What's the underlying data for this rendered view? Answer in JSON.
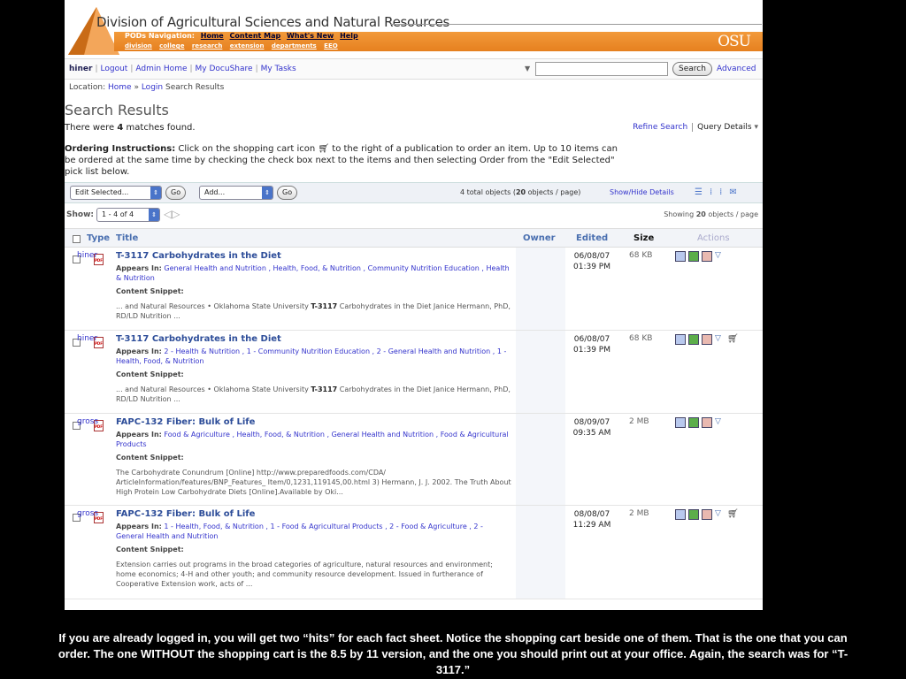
{
  "header": {
    "site_title": "Division of Agricultural Sciences and Natural Resources",
    "pods_label": "PODs Navigation:",
    "pods_links": [
      "Home",
      "Content Map",
      "What's New",
      "Help"
    ],
    "sub_links": [
      "division",
      "college",
      "research",
      "extension",
      "departments",
      "EEO"
    ],
    "logo_text": "OSU"
  },
  "userbar": {
    "username": "hiner",
    "links": [
      "Logout",
      "Admin Home",
      "My DocuShare",
      "My Tasks"
    ],
    "search_value": "",
    "search_button": "Search",
    "advanced_link": "Advanced"
  },
  "location": {
    "label": "Location:",
    "home": "Home",
    "sep": "»",
    "login": "Login",
    "current": "Search Results"
  },
  "page": {
    "title": "Search Results",
    "matches_prefix": "There were",
    "matches_count": "4",
    "matches_suffix": "matches found.",
    "refine_search": "Refine Search",
    "query_details": "Query Details",
    "ordering_label": "Ordering Instructions:",
    "ordering_text_1": "Click on the shopping cart icon",
    "ordering_text_2": "to the right of a publication to order an item. Up to 10 items can be ordered at the same time by checking the check box next to the items and then selecting Order from the \"Edit Selected\" pick list below."
  },
  "toolbar": {
    "edit_selected": "Edit Selected...",
    "go_label": "Go",
    "add_label": "Add...",
    "total_count": "4",
    "total_objects_text": "total objects",
    "per_page": "20",
    "per_page_text": "objects / page",
    "show_hide": "Show/Hide Details"
  },
  "showbar": {
    "show_label": "Show:",
    "range": "1 - 4 of 4",
    "showing_prefix": "Showing",
    "showing_count": "20",
    "showing_suffix": "objects / page"
  },
  "table": {
    "columns": {
      "type": "Type",
      "title": "Title",
      "owner": "Owner",
      "edited": "Edited",
      "size": "Size",
      "actions": "Actions"
    },
    "appears_label": "Appears In:",
    "snippet_label": "Content Snippet:",
    "rows": [
      {
        "title": "T-3117 Carbohydrates in the Diet",
        "appears": "General Health and Nutrition ,  Health, Food, & Nutrition ,  Community Nutrition Education ,  Health & Nutrition",
        "snippet_pre": "... and Natural Resources • Oklahoma State University",
        "snippet_bold": "T-3117",
        "snippet_post": "Carbohydrates in the Diet Janice Hermann, PhD, RD/LD Nutrition ...",
        "owner": "hiner",
        "edited_date": "06/08/07",
        "edited_time": "01:39 PM",
        "size": "68 KB",
        "has_cart": false
      },
      {
        "title": "T-3117 Carbohydrates in the Diet",
        "appears": "2 - Health & Nutrition ,  1 - Community Nutrition Education ,  2 - General Health and Nutrition ,  1 - Health, Food, & Nutrition",
        "snippet_pre": "... and Natural Resources • Oklahoma State University",
        "snippet_bold": "T-3117",
        "snippet_post": "Carbohydrates in the Diet Janice Hermann, PhD, RD/LD Nutrition ...",
        "owner": "hiner",
        "edited_date": "06/08/07",
        "edited_time": "01:39 PM",
        "size": "68 KB",
        "has_cart": true
      },
      {
        "title": "FAPC-132 Fiber: Bulk of Life",
        "appears": "Food & Agriculture ,  Health, Food, & Nutrition ,  General Health and Nutrition ,  Food & Agricultural Products",
        "snippet_pre": "The Carbohydrate Conundrum [Online] http://www.preparedfoods.com/CDA/ ArticleInformation/features/BNP_Features_ Item/0,1231,119145,00.html 3) Hermann, J. J. 2002. The Truth About High Protein Low Carbohydrate Diets [Online].Available by Oki...",
        "snippet_bold": "",
        "snippet_post": "",
        "owner": "gross",
        "edited_date": "08/09/07",
        "edited_time": "09:35 AM",
        "size": "2 MB",
        "has_cart": false
      },
      {
        "title": "FAPC-132 Fiber: Bulk of Life",
        "appears": "1 - Health, Food, & Nutrition ,  1 - Food & Agricultural Products ,  2 - Food & Agriculture ,  2 - General Health and Nutrition",
        "snippet_pre": "Extension carries out programs in the broad categories of agriculture, natural resources and environment; home economics; 4-H and other youth; and community resource development. Issued in furtherance of Cooperative Extension work, acts of ...",
        "snippet_bold": "",
        "snippet_post": "",
        "owner": "gross",
        "edited_date": "08/08/07",
        "edited_time": "11:29 AM",
        "size": "2 MB",
        "has_cart": true
      }
    ]
  },
  "caption": "If you are already logged in, you will get two “hits” for each fact sheet.  Notice the shopping cart beside one of them. That is the one that you can order. The one WITHOUT the shopping cart is the 8.5 by 11 version, and the one you should print out at your office. Again, the search was for “T-3117.”",
  "colors": {
    "orange": "#e6801f",
    "link": "#3333cc",
    "title_blue": "#2d4d99"
  }
}
